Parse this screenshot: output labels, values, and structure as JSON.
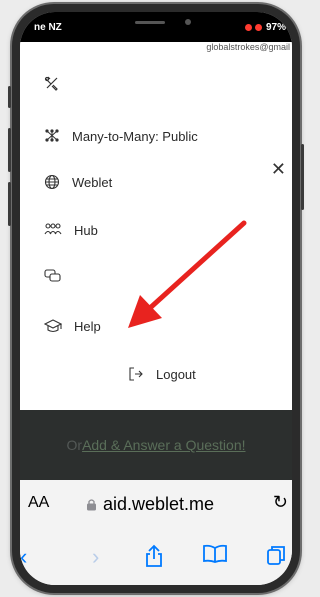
{
  "status_bar": {
    "carrier": "ne NZ",
    "battery": "97%"
  },
  "email": "globalstrokes@gmail",
  "menu": {
    "items": [
      {
        "label": "Many-to-Many: Public",
        "icon": "grid-nodes-icon"
      },
      {
        "label": "Weblet",
        "icon": "globe-icon"
      },
      {
        "label": "Hub",
        "icon": "people-icon"
      },
      {
        "label": "Help",
        "icon": "graduation-cap-icon"
      }
    ],
    "logout_label": "Logout"
  },
  "banner": {
    "prefix": "Or ",
    "link": "Add & Answer a Question!"
  },
  "browser": {
    "text_size": "AA",
    "url": "aid.weblet.me"
  },
  "colors": {
    "arrow": "#e8231f",
    "toolbar_blue": "#007aff"
  }
}
